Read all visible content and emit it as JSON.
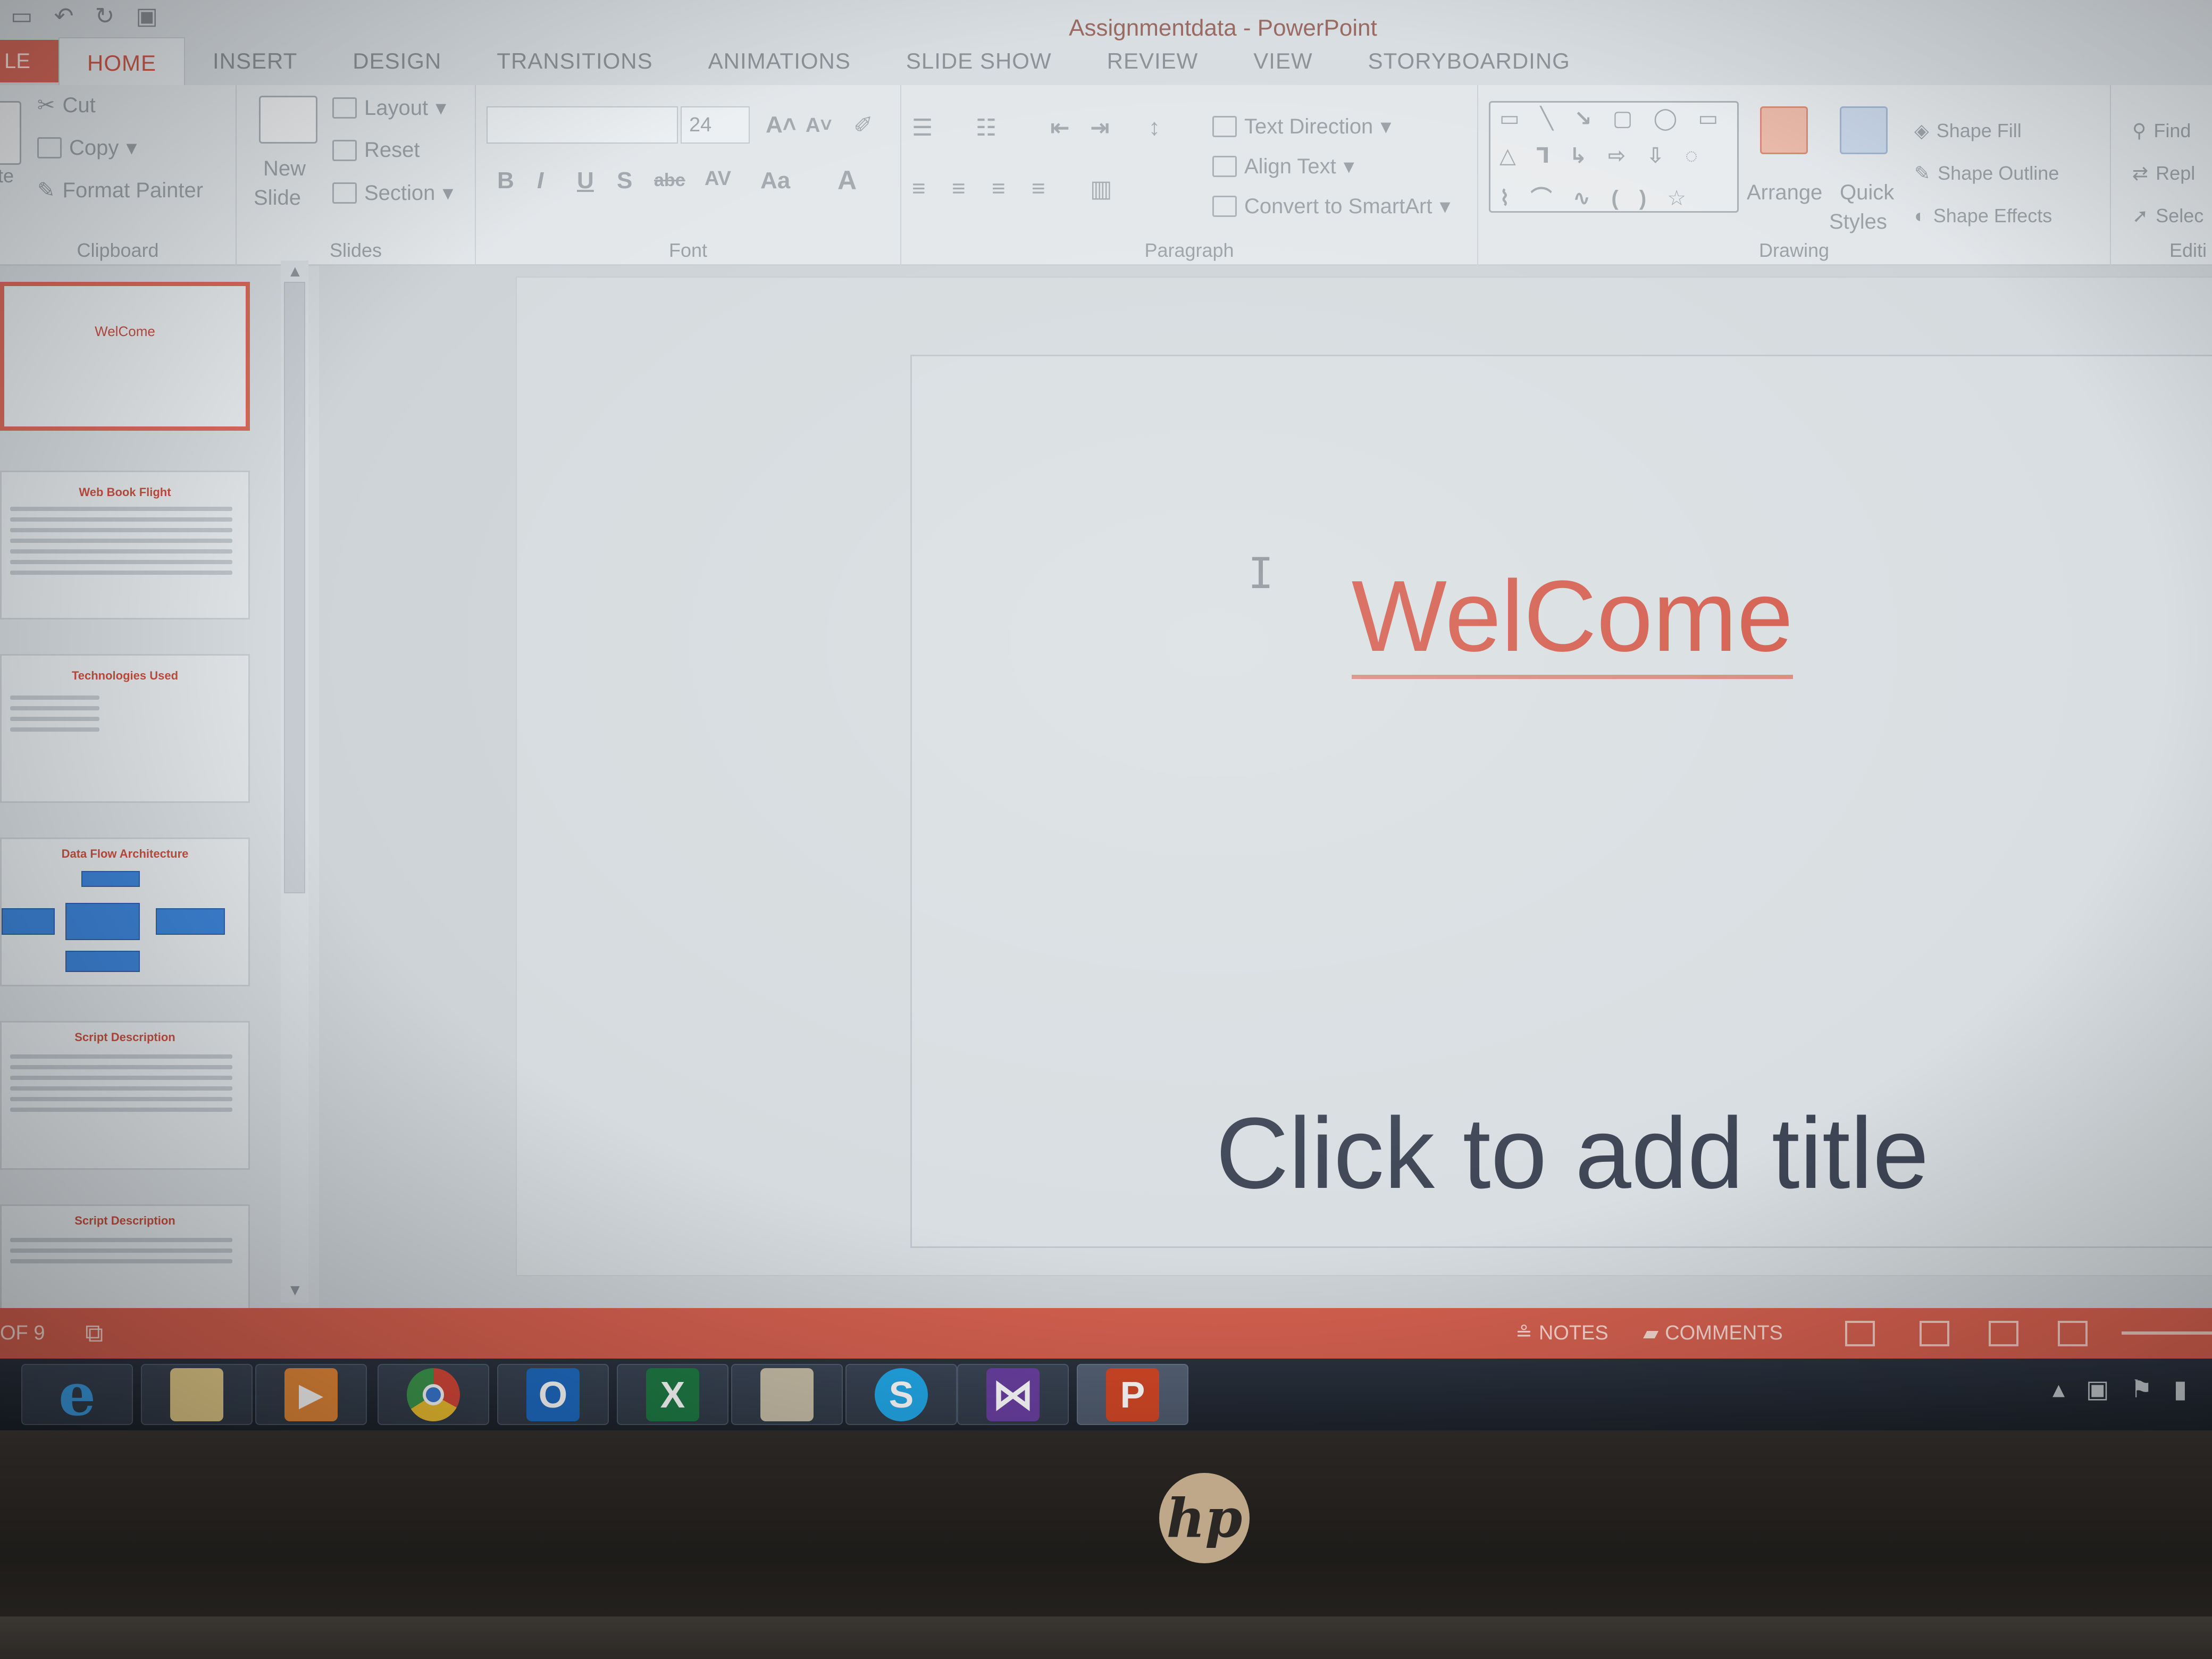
{
  "window": {
    "title": "Assignmentdata - PowerPoint"
  },
  "tabs": {
    "file": "LE",
    "items": [
      "HOME",
      "INSERT",
      "DESIGN",
      "TRANSITIONS",
      "ANIMATIONS",
      "SLIDE SHOW",
      "REVIEW",
      "VIEW",
      "STORYBOARDING"
    ],
    "active": "HOME"
  },
  "ribbon": {
    "clipboard": {
      "label": "Clipboard",
      "paste": "te",
      "cut": "Cut",
      "copy": "Copy",
      "format_painter": "Format Painter"
    },
    "slides": {
      "label": "Slides",
      "new_slide_1": "New",
      "new_slide_2": "Slide",
      "layout": "Layout",
      "reset": "Reset",
      "section": "Section"
    },
    "font": {
      "label": "Font",
      "font_name": "",
      "font_size": "24",
      "bold": "B",
      "italic": "I",
      "underline": "U",
      "shadow": "S",
      "strike": "abc",
      "spacing": "AV",
      "case": "Aa",
      "color": "A"
    },
    "paragraph": {
      "label": "Paragraph",
      "text_direction": "Text Direction",
      "align_text": "Align Text",
      "smartart": "Convert to SmartArt"
    },
    "drawing": {
      "label": "Drawing",
      "arrange": "Arrange",
      "quick_styles_1": "Quick",
      "quick_styles_2": "Styles",
      "shape_fill": "Shape Fill",
      "shape_outline": "Shape Outline",
      "shape_effects": "Shape Effects"
    },
    "editing": {
      "label": "Editi",
      "find": "Find",
      "replace": "Repl",
      "select": "Selec"
    }
  },
  "thumbnails": [
    {
      "title": "WelCome",
      "selected": true
    },
    {
      "title": "Web Book Flight",
      "selected": false
    },
    {
      "title": "Technologies Used",
      "selected": false
    },
    {
      "title": "Data Flow Architecture",
      "selected": false
    },
    {
      "title": "Script Description",
      "selected": false
    },
    {
      "title": "Script Description",
      "selected": false
    }
  ],
  "slide": {
    "heading": "WelCome",
    "title_placeholder": "Click to add title"
  },
  "status": {
    "slide_count": "OF 9",
    "notes": "NOTES",
    "comments": "COMMENTS"
  },
  "taskbar": {
    "apps": [
      "internet-explorer",
      "file-explorer",
      "media-player",
      "chrome",
      "outlook",
      "excel",
      "files",
      "skype",
      "visual-studio",
      "powerpoint"
    ],
    "icon_labels": {
      "ie": "e",
      "outlook": "O",
      "excel": "X",
      "skype": "S",
      "vs": "⋈",
      "ppt": "P"
    }
  },
  "bezel": {
    "logo": "hp"
  },
  "colors": {
    "accent": "#d4604f",
    "heading": "#d35a4a",
    "placeholder": "#3e4656"
  }
}
